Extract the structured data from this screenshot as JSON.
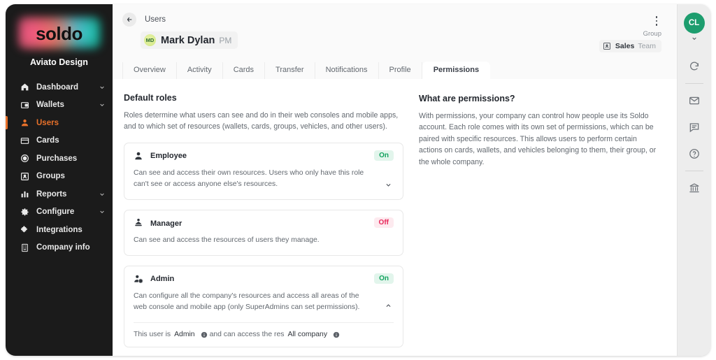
{
  "brand": {
    "logo_text": "soldo",
    "company": "Aviato Design"
  },
  "sidebar": {
    "items": [
      {
        "label": "Dashboard",
        "icon": "home-icon",
        "chevron": true,
        "active": false
      },
      {
        "label": "Wallets",
        "icon": "wallet-icon",
        "chevron": true,
        "active": false
      },
      {
        "label": "Users",
        "icon": "user-icon",
        "chevron": false,
        "active": true
      },
      {
        "label": "Cards",
        "icon": "card-icon",
        "chevron": false,
        "active": false
      },
      {
        "label": "Purchases",
        "icon": "purchases-icon",
        "chevron": false,
        "active": false
      },
      {
        "label": "Groups",
        "icon": "groups-icon",
        "chevron": false,
        "active": false
      },
      {
        "label": "Reports",
        "icon": "reports-icon",
        "chevron": true,
        "active": false
      },
      {
        "label": "Configure",
        "icon": "gear-icon",
        "chevron": true,
        "active": false
      },
      {
        "label": "Integrations",
        "icon": "puzzle-icon",
        "chevron": false,
        "active": false
      },
      {
        "label": "Company info",
        "icon": "building-icon",
        "chevron": false,
        "active": false
      }
    ]
  },
  "header": {
    "breadcrumb": "Users",
    "back_icon": "arrow-left-icon",
    "user": {
      "initials": "MD",
      "name": "Mark Dylan",
      "role": "PM"
    },
    "kebab_icon": "more-vertical-icon",
    "group": {
      "label": "Group",
      "icon": "group-badge-icon",
      "name": "Sales",
      "suffix": "Team"
    }
  },
  "tabs": [
    {
      "label": "Overview",
      "active": false
    },
    {
      "label": "Activity",
      "active": false
    },
    {
      "label": "Cards",
      "active": false
    },
    {
      "label": "Transfer",
      "active": false
    },
    {
      "label": "Notifications",
      "active": false
    },
    {
      "label": "Profile",
      "active": false
    },
    {
      "label": "Permissions",
      "active": true
    }
  ],
  "main": {
    "default_roles": {
      "title": "Default roles",
      "description": "Roles determine what users can see and do in their web consoles and mobile apps, and to which set of resources (wallets, cards, groups, vehicles, and other users).",
      "roles": [
        {
          "name": "Employee",
          "icon": "employee-icon",
          "status": "On",
          "status_state": "on",
          "description": "Can see and access their own resources. Users who only have this role can't see or access anyone else's resources.",
          "chevron": "chevron-down-icon",
          "expanded": false
        },
        {
          "name": "Manager",
          "icon": "manager-icon",
          "status": "Off",
          "status_state": "off",
          "description": "Can see and access the resources of users they manage.",
          "chevron": "",
          "expanded": false
        },
        {
          "name": "Admin",
          "icon": "admin-icon",
          "status": "On",
          "status_state": "on",
          "description": "Can configure all the company's resources and access all areas of the web console and mobile app (only SuperAdmins can set permissions).",
          "chevron": "chevron-up-icon",
          "expanded": true,
          "detail": {
            "prefix": "This user is",
            "value_1": "Admin",
            "middle": "and can access the res",
            "value_2": "All company",
            "info_icon": "info-icon"
          }
        }
      ]
    },
    "info_panel": {
      "title": "What are permissions?",
      "body": "With permissions, your company can control how people use its Soldo account. Each role comes with its own set of permissions, which can be paired with specific resources. This allows users to perform certain actions on cards, wallets, and vehicles belonging to them, their group, or the whole company."
    }
  },
  "rail": {
    "avatar_initials": "CL",
    "avatar_color": "#1d9d6e",
    "items": [
      {
        "icon": "chevron-down-icon"
      },
      {
        "icon": "refresh-icon"
      },
      {
        "icon": "divider"
      },
      {
        "icon": "mail-icon"
      },
      {
        "icon": "chat-icon"
      },
      {
        "icon": "help-icon"
      },
      {
        "icon": "divider"
      },
      {
        "icon": "bank-icon"
      }
    ]
  },
  "colors": {
    "accent": "#e8712a",
    "sidebar_bg": "#1b1b1b",
    "on_badge": "#12a35f",
    "off_badge": "#e8295b",
    "rail_avatar": "#1d9d6e"
  }
}
